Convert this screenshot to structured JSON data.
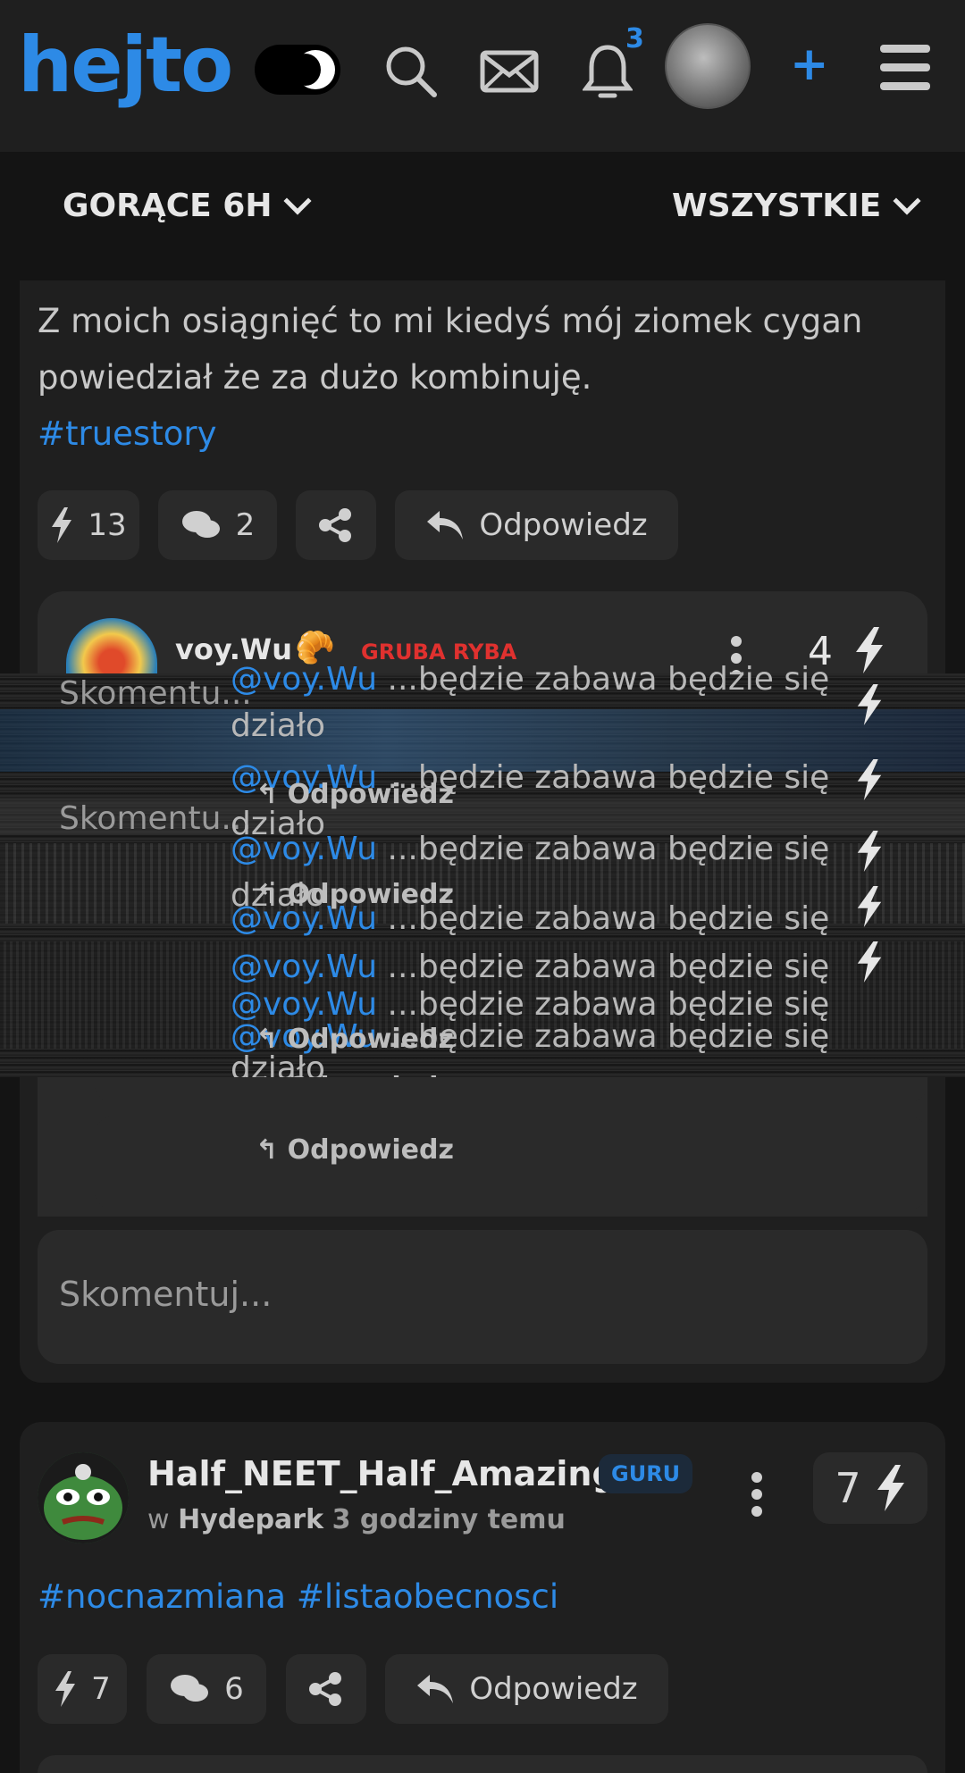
{
  "header": {
    "logo": "hejto",
    "notification_count": "3",
    "add_label": "+"
  },
  "filters": {
    "sort_label": "GORĄCE 6H",
    "scope_label": "WSZYSTKIE"
  },
  "post1": {
    "text_line1": "Z moich osiągnięć to mi kiedyś mój ziomek cygan",
    "text_line2": "powiedział że za dużo kombinuję.",
    "hashtag": "#truestory",
    "likes": "13",
    "comments": "2",
    "reply_label": "Odpowiedz",
    "comment_placeholder": "Skomentuj..."
  },
  "comment": {
    "author": "voy.Wu",
    "rank": "GRUBA RYBA",
    "rank_color": "#e0312f",
    "score": "4",
    "mention": "@voy.Wu",
    "text": "...będzie zabawa będzie się",
    "text_cont": "działo",
    "reply_label": "Odpowiedz",
    "comment_placeholder": "Skomentu..."
  },
  "post2": {
    "author": "Half_NEET_Half_Amazing",
    "badge": "GURU",
    "community_prefix": "w",
    "community": "Hydepark",
    "time": "3 godziny temu",
    "score": "7",
    "hashtags": "#nocnazmiana #listaobecnosci",
    "likes": "7",
    "comments": "6",
    "reply_label": "Odpowiedz"
  },
  "colors": {
    "accent": "#2d8ae6",
    "background": "#141414",
    "card": "#1f1f1f"
  }
}
